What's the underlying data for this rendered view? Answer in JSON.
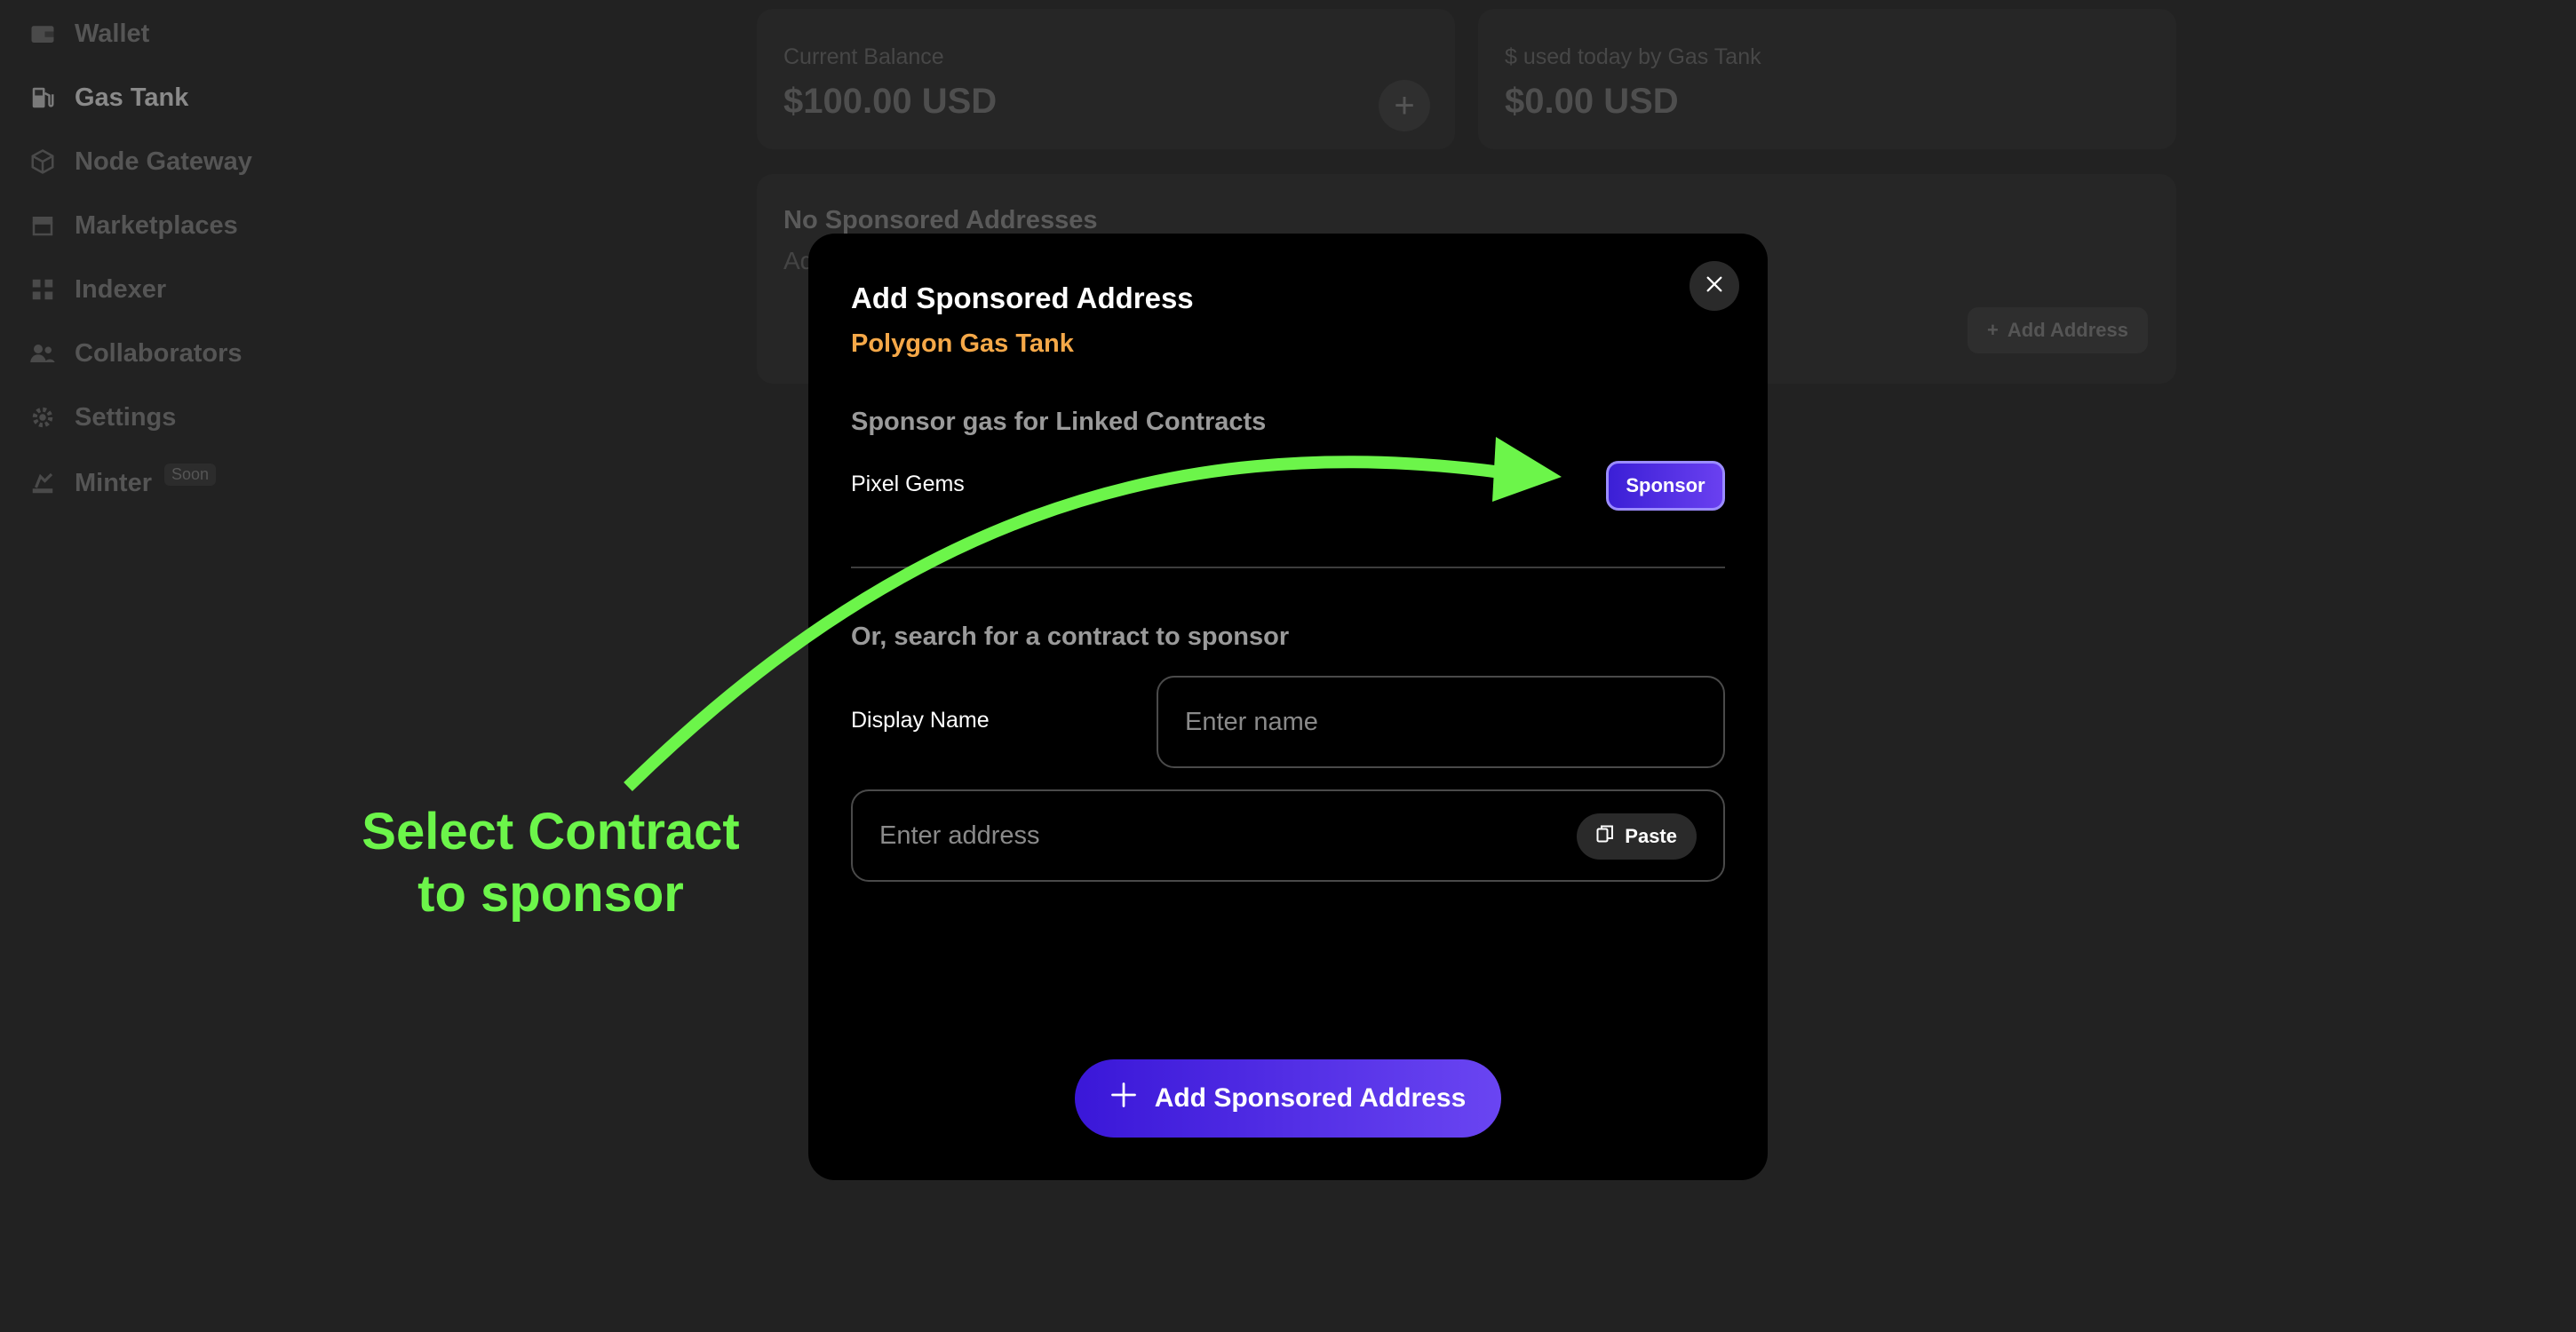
{
  "sidebar": {
    "items": [
      {
        "label": "Wallet",
        "icon": "wallet-icon"
      },
      {
        "label": "Gas Tank",
        "icon": "gas-pump-icon"
      },
      {
        "label": "Node Gateway",
        "icon": "cube-icon"
      },
      {
        "label": "Marketplaces",
        "icon": "storefront-icon"
      },
      {
        "label": "Indexer",
        "icon": "grid-icon"
      },
      {
        "label": "Collaborators",
        "icon": "users-icon"
      },
      {
        "label": "Settings",
        "icon": "gear-icon"
      },
      {
        "label": "Minter",
        "icon": "mint-icon",
        "badge": "Soon"
      }
    ]
  },
  "balance_card": {
    "label": "Current Balance",
    "value": "$100.00 USD",
    "add_icon": "+"
  },
  "usage_card": {
    "label": "$ used today by Gas Tank",
    "value": "$0.00 USD"
  },
  "sponsored_card": {
    "title": "No Sponsored Addresses",
    "subtitle": "Ad",
    "add_button": "Add Address"
  },
  "modal": {
    "title": "Add Sponsored Address",
    "subtitle": "Polygon Gas Tank",
    "linked_heading": "Sponsor gas for Linked Contracts",
    "contracts": [
      {
        "name": "Pixel Gems",
        "action": "Sponsor"
      }
    ],
    "search_heading": "Or, search for a contract to sponsor",
    "display_name_label": "Display Name",
    "name_placeholder": "Enter name",
    "address_placeholder": "Enter address",
    "paste_label": "Paste",
    "submit_label": "Add Sponsored Address"
  },
  "annotation": {
    "line1": "Select Contract",
    "line2": "to sponsor",
    "color": "#6cf54a"
  },
  "colors": {
    "accent": "#5a32ea",
    "subtitle": "#f5a848",
    "background": "#222222"
  }
}
